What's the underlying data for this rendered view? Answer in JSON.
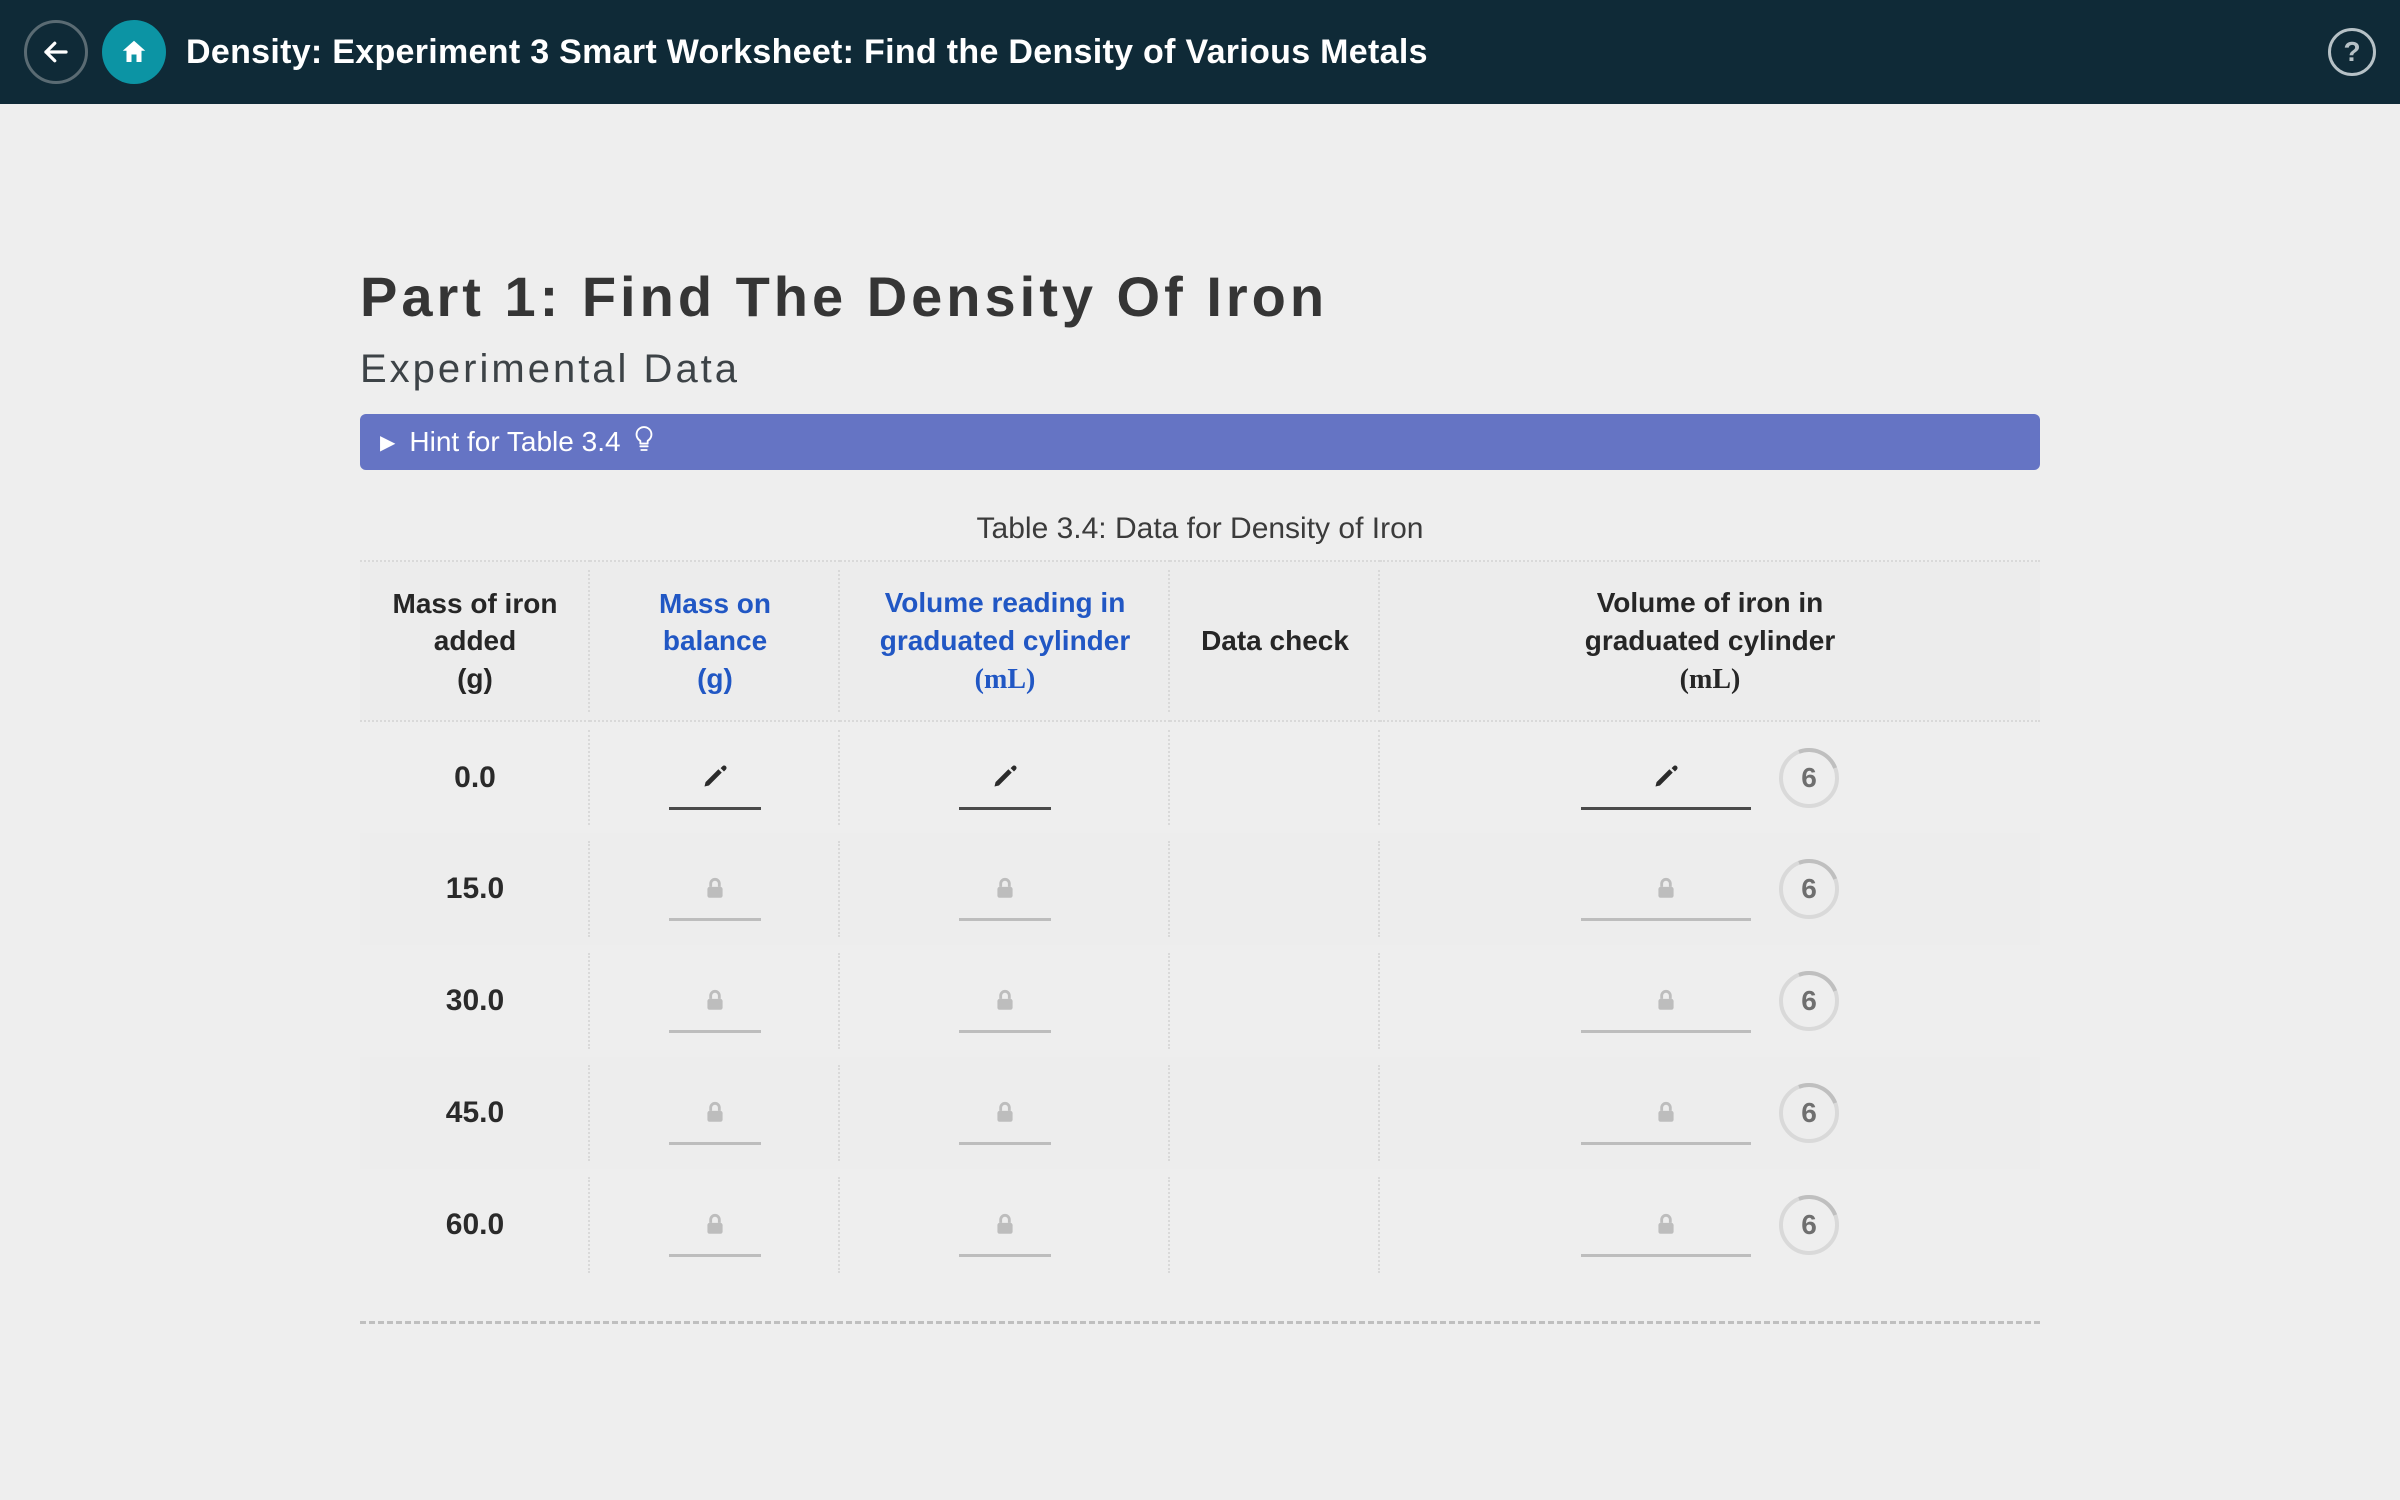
{
  "appbar": {
    "title": "Density: Experiment 3 Smart Worksheet: Find the Density of Various Metals"
  },
  "headings": {
    "part": "Part 1: Find The Density Of Iron",
    "section": "Experimental Data"
  },
  "hint": {
    "label": "Hint for Table 3.4"
  },
  "table": {
    "caption": "Table 3.4: Data for Density of Iron",
    "columns": {
      "c0": {
        "line1": "Mass of iron",
        "line2": "added",
        "unit": "(g)",
        "link": false
      },
      "c1": {
        "line1": "Mass on",
        "line2": "balance",
        "unit": "(g)",
        "link": true
      },
      "c2": {
        "line1": "Volume reading in",
        "line2": "graduated cylinder",
        "unit_math": "(mL)",
        "link": true
      },
      "c3": {
        "line1": "Data check",
        "link": false
      },
      "c4": {
        "line1": "Volume of iron in",
        "line2": "graduated cylinder",
        "unit_math": "(mL)",
        "link": false
      }
    },
    "rows": [
      {
        "mass_added": "0.0",
        "editable": true,
        "attempts": "6"
      },
      {
        "mass_added": "15.0",
        "editable": false,
        "attempts": "6"
      },
      {
        "mass_added": "30.0",
        "editable": false,
        "attempts": "6"
      },
      {
        "mass_added": "45.0",
        "editable": false,
        "attempts": "6"
      },
      {
        "mass_added": "60.0",
        "editable": false,
        "attempts": "6"
      }
    ]
  },
  "chart_data": {
    "type": "table",
    "title": "Table 3.4: Data for Density of Iron",
    "columns": [
      "Mass of iron added (g)",
      "Mass on balance (g)",
      "Volume reading in graduated cylinder (mL)",
      "Data check",
      "Volume of iron in graduated cylinder (mL)"
    ],
    "rows": [
      {
        "mass_added_g": 0.0,
        "mass_on_balance_g": null,
        "volume_reading_mL": null,
        "data_check": null,
        "volume_iron_mL": null,
        "attempts_remaining": 6,
        "state": "editable"
      },
      {
        "mass_added_g": 15.0,
        "mass_on_balance_g": null,
        "volume_reading_mL": null,
        "data_check": null,
        "volume_iron_mL": null,
        "attempts_remaining": 6,
        "state": "locked"
      },
      {
        "mass_added_g": 30.0,
        "mass_on_balance_g": null,
        "volume_reading_mL": null,
        "data_check": null,
        "volume_iron_mL": null,
        "attempts_remaining": 6,
        "state": "locked"
      },
      {
        "mass_added_g": 45.0,
        "mass_on_balance_g": null,
        "volume_reading_mL": null,
        "data_check": null,
        "volume_iron_mL": null,
        "attempts_remaining": 6,
        "state": "locked"
      },
      {
        "mass_added_g": 60.0,
        "mass_on_balance_g": null,
        "volume_reading_mL": null,
        "data_check": null,
        "volume_iron_mL": null,
        "attempts_remaining": 6,
        "state": "locked"
      }
    ]
  }
}
